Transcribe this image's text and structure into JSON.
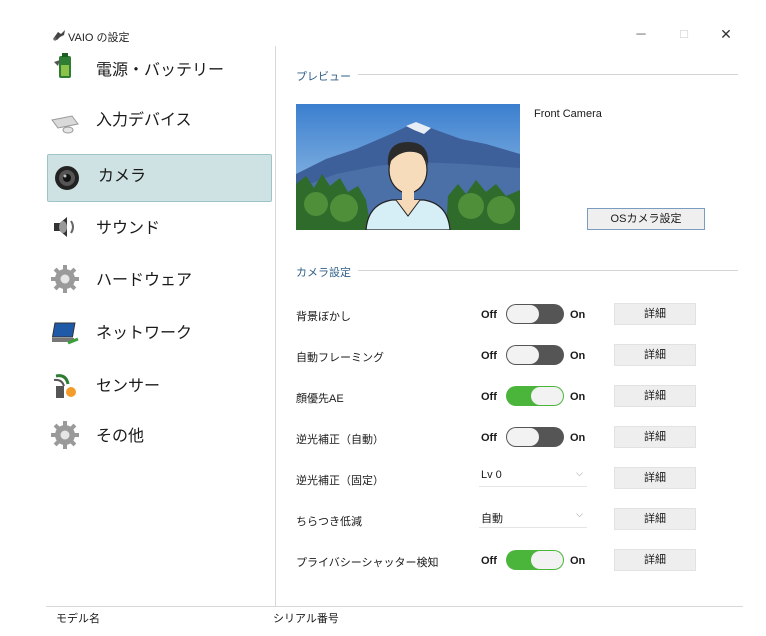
{
  "window": {
    "title": "VAIO の設定",
    "minimize": "─",
    "maximize": "□",
    "close": "✕"
  },
  "sidebar": {
    "items": [
      {
        "label": "電源・バッテリー",
        "icon": "battery-icon"
      },
      {
        "label": "入力デバイス",
        "icon": "mouse-icon"
      },
      {
        "label": "カメラ",
        "icon": "camera-icon",
        "selected": true
      },
      {
        "label": "サウンド",
        "icon": "speaker-icon"
      },
      {
        "label": "ハードウェア",
        "icon": "gear-icon"
      },
      {
        "label": "ネットワーク",
        "icon": "network-icon"
      },
      {
        "label": "センサー",
        "icon": "sensor-icon"
      },
      {
        "label": "その他",
        "icon": "gear-icon"
      }
    ]
  },
  "preview": {
    "header": "プレビュー",
    "camera_name": "Front Camera",
    "os_camera_button": "OSカメラ設定"
  },
  "camera_settings": {
    "header": "カメラ設定",
    "detail_label": "詳細",
    "rows": [
      {
        "label": "背景ぼかし",
        "type": "toggle",
        "off_label": "Off",
        "on_label": "On",
        "state": "off"
      },
      {
        "label": "自動フレーミング",
        "type": "toggle",
        "off_label": "Off",
        "on_label": "On",
        "state": "off"
      },
      {
        "label": "顔優先AE",
        "type": "toggle",
        "off_label": "Off",
        "on_label": "On",
        "state": "on"
      },
      {
        "label": "逆光補正（自動）",
        "type": "toggle",
        "off_label": "Off",
        "on_label": "On",
        "state": "off"
      },
      {
        "label": "逆光補正（固定）",
        "type": "select",
        "value": "Lv 0"
      },
      {
        "label": "ちらつき低減",
        "type": "select",
        "value": "自動"
      },
      {
        "label": "プライバシーシャッター検知",
        "type": "toggle",
        "off_label": "Off",
        "on_label": "On",
        "state": "on"
      }
    ]
  },
  "footer": {
    "model_label": "モデル名",
    "serial_label": "シリアル番号"
  },
  "colors": {
    "accent_header": "#2f5f8a",
    "toggle_on": "#4ab53a",
    "toggle_off": "#555555",
    "selected_nav_bg": "#cfe2e3"
  }
}
